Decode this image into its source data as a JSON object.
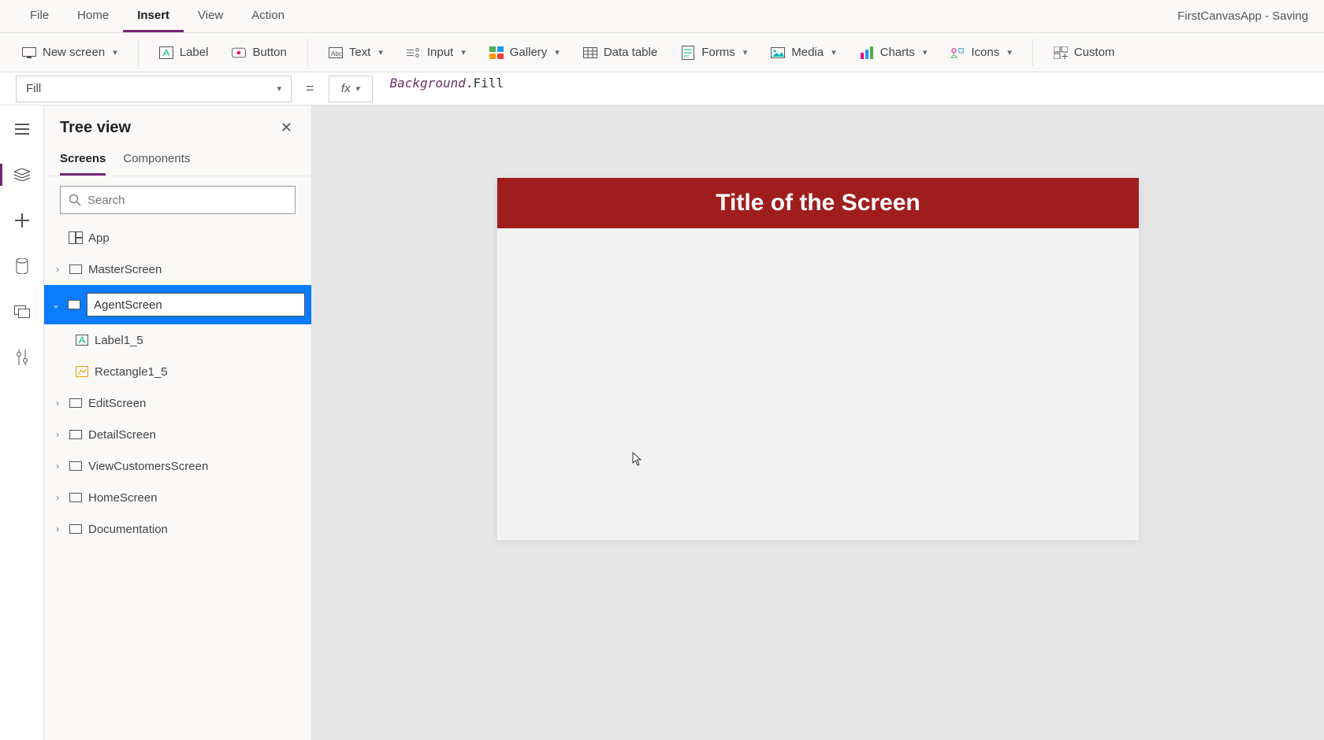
{
  "menu": {
    "file": "File",
    "home": "Home",
    "insert": "Insert",
    "view": "View",
    "action": "Action"
  },
  "appTitle": "FirstCanvasApp - Saving ",
  "ribbon": {
    "newScreen": "New screen",
    "label": "Label",
    "button": "Button",
    "text": "Text",
    "input": "Input",
    "gallery": "Gallery",
    "dataTable": "Data table",
    "forms": "Forms",
    "media": "Media",
    "charts": "Charts",
    "icons": "Icons",
    "custom": "Custom"
  },
  "formula": {
    "property": "Fill",
    "object": "Background",
    "member": ".Fill"
  },
  "tree": {
    "title": "Tree view",
    "tabs": {
      "screens": "Screens",
      "components": "Components"
    },
    "searchPlaceholder": "Search",
    "app": "App",
    "items": {
      "master": "MasterScreen",
      "agentEdit": "AgentScreen",
      "label": "Label1_5",
      "rect": "Rectangle1_5",
      "edit": "EditScreen",
      "detail": "DetailScreen",
      "viewCust": "ViewCustomersScreen",
      "home": "HomeScreen",
      "doc": "Documentation"
    }
  },
  "canvas": {
    "screenTitle": "Title of the Screen"
  }
}
